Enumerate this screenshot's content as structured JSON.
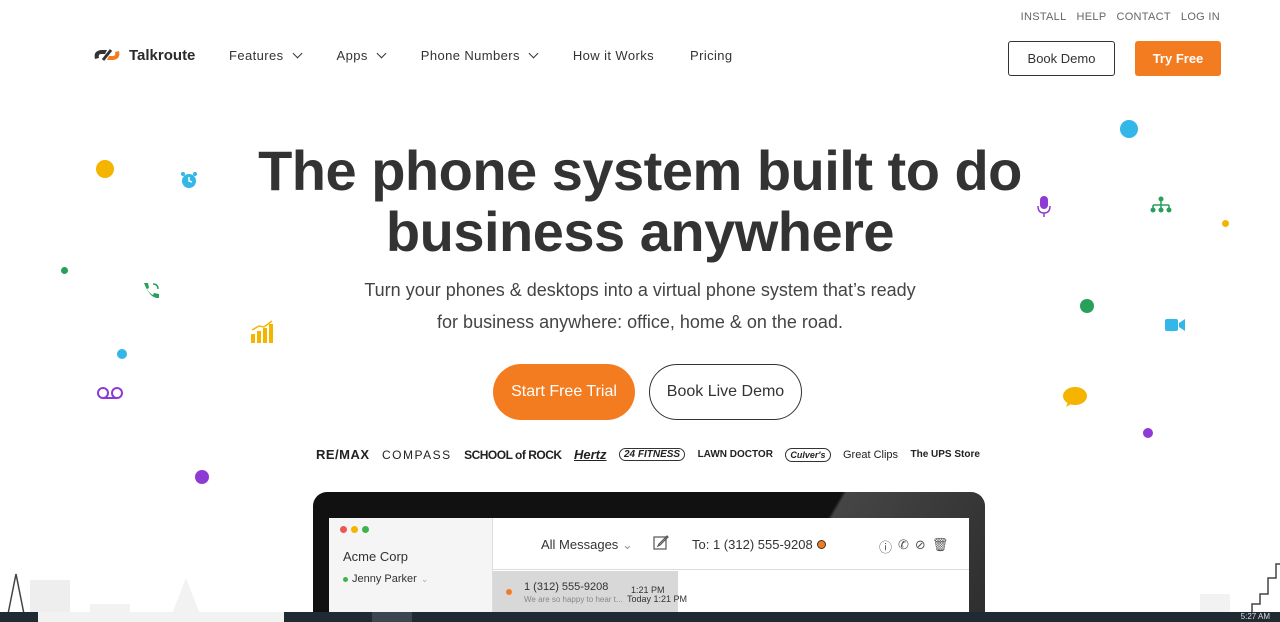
{
  "topbar": {
    "links": [
      "INSTALL",
      "HELP",
      "CONTACT",
      "LOG IN"
    ]
  },
  "brand": {
    "name": "Talkroute",
    "accent": "#f47c20"
  },
  "nav": {
    "items": [
      {
        "label": "Features",
        "dropdown": true
      },
      {
        "label": "Apps",
        "dropdown": true
      },
      {
        "label": "Phone Numbers",
        "dropdown": true
      },
      {
        "label": "How it Works",
        "dropdown": false
      },
      {
        "label": "Pricing",
        "dropdown": false
      }
    ]
  },
  "header_buttons": {
    "demo": "Book Demo",
    "try": "Try Free"
  },
  "hero": {
    "title_line1": "The phone system built to do",
    "title_line2": "business anywhere",
    "sub_line1": "Turn your phones & desktops into a virtual phone system that’s ready",
    "sub_line2": "for business anywhere: office, home & on the road.",
    "cta_primary": "Start Free Trial",
    "cta_secondary": "Book Live Demo"
  },
  "customer_logos": [
    "RE/MAX",
    "COMPASS",
    "SCHOOL of ROCK",
    "Hertz",
    "24 FITNESS",
    "LAWN DOCTOR",
    "Culver's",
    "Great Clips",
    "The UPS Store"
  ],
  "decor_icons": [
    "alarm-clock-icon",
    "phone-ringing-icon",
    "bar-chart-icon",
    "voicemail-icon",
    "microphone-icon",
    "org-chart-icon",
    "video-camera-icon",
    "chat-bubble-icon"
  ],
  "app_preview": {
    "company": "Acme Corp",
    "user": "Jenny Parker",
    "filter": "All Messages",
    "to": "To: 1 (312) 555-9208",
    "message": {
      "number": "1 (312) 555-9208",
      "time": "1:21 PM",
      "preview": "We are so happy to hear t..."
    },
    "day_stamp": "Today 1:21 PM"
  },
  "taskbar": {
    "clock": "5:27 AM"
  }
}
